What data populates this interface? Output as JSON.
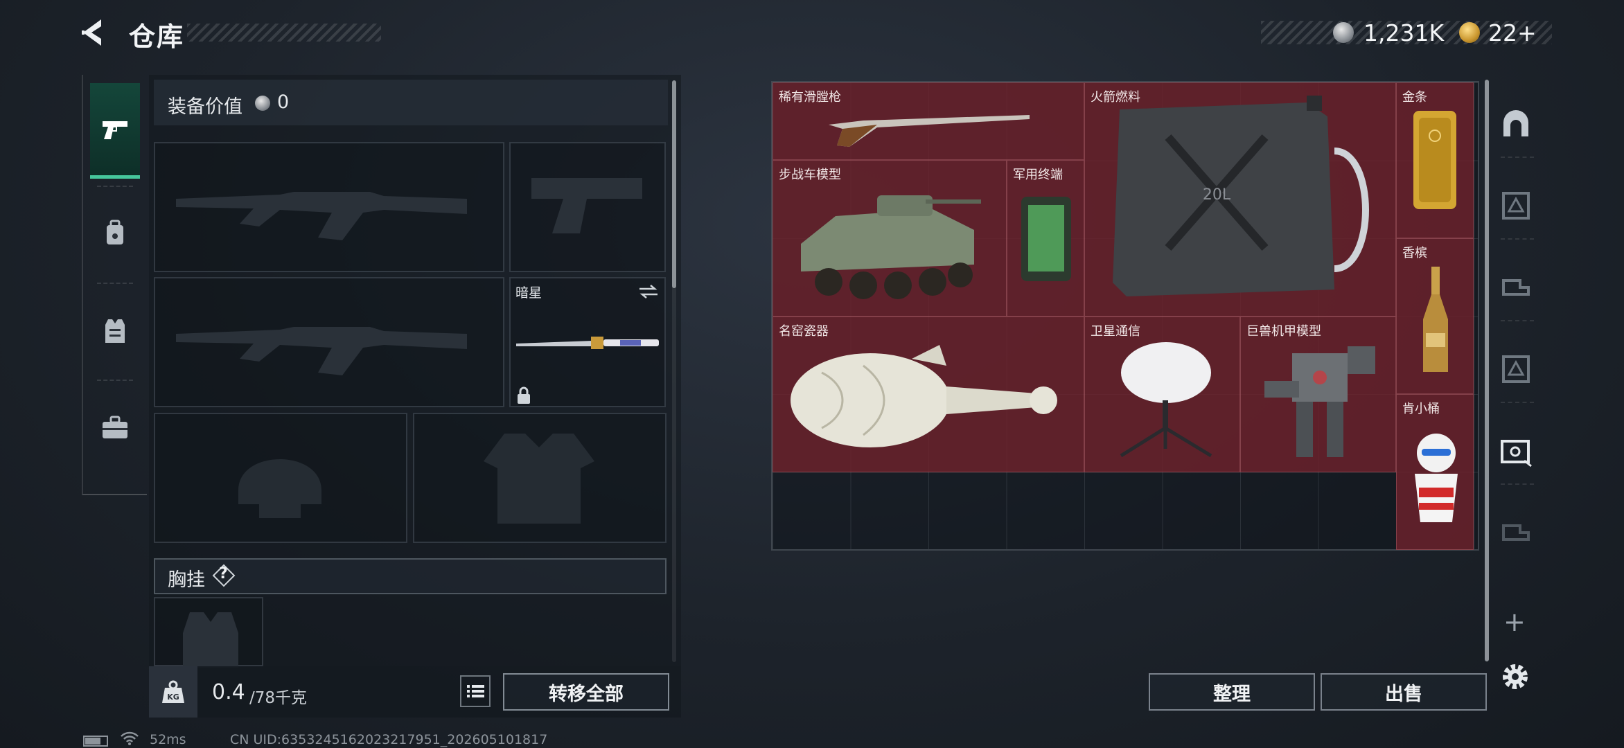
{
  "header": {
    "title": "仓库",
    "coin_value": "1,231K",
    "gem_value": "22+"
  },
  "left_tabs": [
    {
      "icon": "pistol-icon",
      "active": true
    },
    {
      "icon": "backpack-icon",
      "active": false
    },
    {
      "icon": "vest-icon",
      "active": false
    },
    {
      "icon": "briefcase-icon",
      "active": false
    }
  ],
  "loadout": {
    "equip_value_label": "装备价值",
    "equip_value": "0",
    "melee_name": "暗星",
    "chest_label": "胸挂",
    "chest_help": "?",
    "weight_current": "0.4",
    "weight_max": "/78千克",
    "transfer_all": "转移全部"
  },
  "stash_items": [
    {
      "name": "稀有滑膛枪",
      "icon": "musket-icon"
    },
    {
      "name": "火箭燃料",
      "icon": "jerrycan-icon"
    },
    {
      "name": "金条",
      "icon": "gold-bar-icon"
    },
    {
      "name": "步战车模型",
      "icon": "ifv-model-icon"
    },
    {
      "name": "军用终端",
      "icon": "terminal-icon"
    },
    {
      "name": "香槟",
      "icon": "champagne-icon"
    },
    {
      "name": "名窑瓷器",
      "icon": "porcelain-icon"
    },
    {
      "name": "卫星通信",
      "icon": "satellite-dish-icon"
    },
    {
      "name": "巨兽机甲模型",
      "icon": "mech-model-icon"
    },
    {
      "name": "肯小桶",
      "icon": "bucket-figure-icon"
    }
  ],
  "stash_actions": {
    "sort": "整理",
    "sell": "出售",
    "add": "+"
  },
  "status_bar": {
    "ping": "52ms",
    "uid": "CN UID:635324516202321​7951_202605101817"
  },
  "colors": {
    "accent": "#46c79c",
    "item_bg": "#6e222c"
  }
}
